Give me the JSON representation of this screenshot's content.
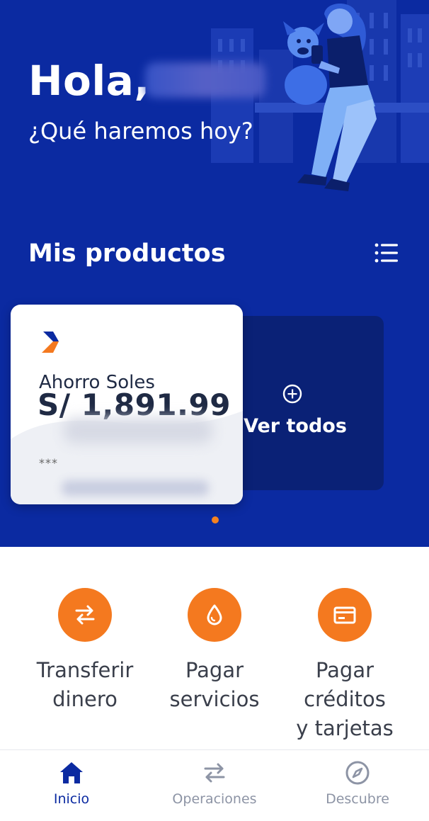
{
  "header": {
    "greeting": "Hola,",
    "subtitle": "¿Qué haremos hoy?"
  },
  "products": {
    "title": "Mis productos",
    "list_icon": "list-icon",
    "card": {
      "brand_icon": "chevron-logo-icon",
      "account_name": "Ahorro Soles",
      "balance": "S/ 1,891.99",
      "account_number_masked": "***"
    },
    "view_all": {
      "icon": "plus-circle-icon",
      "label": "Ver todos"
    },
    "pagination": {
      "pages": 1,
      "current": 1
    }
  },
  "actions": [
    {
      "icon": "transfer-arrows-icon",
      "line1": "Transferir",
      "line2": "dinero",
      "line3": ""
    },
    {
      "icon": "water-drop-icon",
      "line1": "Pagar",
      "line2": "servicios",
      "line3": ""
    },
    {
      "icon": "credit-card-icon",
      "line1": "Pagar",
      "line2": "créditos",
      "line3": "y tarjetas"
    }
  ],
  "bottom_nav": [
    {
      "icon": "home-icon",
      "label": "Inicio",
      "active": true
    },
    {
      "icon": "transfer-arrows-icon",
      "label": "Operaciones",
      "active": false
    },
    {
      "icon": "compass-icon",
      "label": "Descubre",
      "active": false
    }
  ],
  "colors": {
    "brand_blue": "#0b2aa1",
    "dark_blue_card": "#0a2176",
    "accent_orange": "#f4791f",
    "nav_active": "#0b2aa1",
    "nav_inactive": "#8d94a5"
  }
}
